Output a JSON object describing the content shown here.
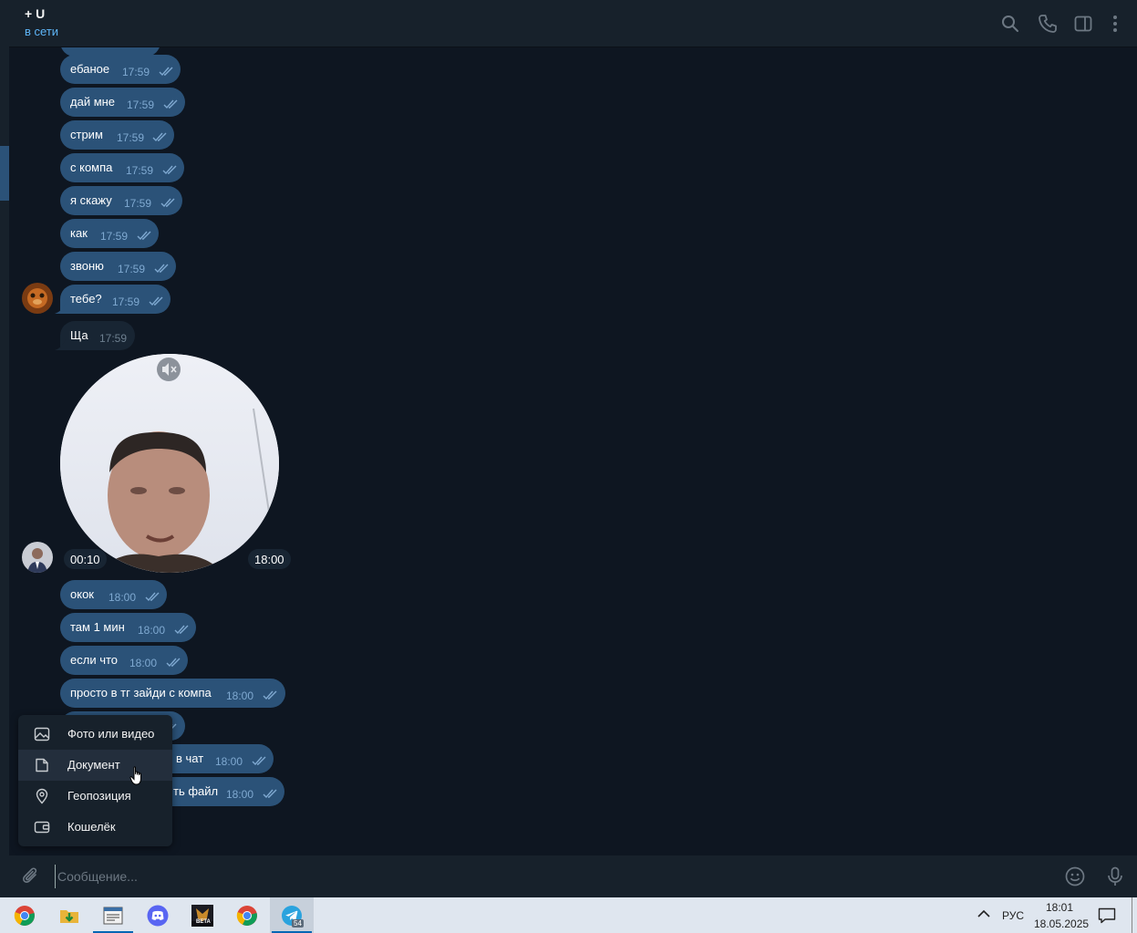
{
  "header": {
    "contact_name": "+ U",
    "status": "в сети",
    "icons": [
      "search-icon",
      "phone-icon",
      "sidebar-toggle-icon",
      "more-vertical-icon"
    ]
  },
  "messages": [
    {
      "text": "ебаное",
      "time": "17:59",
      "dir": "out"
    },
    {
      "text": "дай мне",
      "time": "17:59",
      "dir": "out"
    },
    {
      "text": "стрим",
      "time": "17:59",
      "dir": "out"
    },
    {
      "text": "с компа",
      "time": "17:59",
      "dir": "out"
    },
    {
      "text": "я скажу",
      "time": "17:59",
      "dir": "out"
    },
    {
      "text": "как",
      "time": "17:59",
      "dir": "out"
    },
    {
      "text": "звоню",
      "time": "17:59",
      "dir": "out"
    },
    {
      "text": "тебе?",
      "time": "17:59",
      "dir": "out"
    },
    {
      "text": "Ща",
      "time": "17:59",
      "dir": "in"
    },
    {
      "text": "окок",
      "time": "18:00",
      "dir": "out"
    },
    {
      "text": "там 1 мин",
      "time": "18:00",
      "dir": "out"
    },
    {
      "text": "если что",
      "time": "18:00",
      "dir": "out"
    },
    {
      "text": "просто в тг зайди с компа",
      "time": "18:00",
      "dir": "out"
    },
    {
      "text": "в чат",
      "time": "18:00",
      "dir": "out"
    },
    {
      "text": "ть файл",
      "time": "18:00",
      "dir": "out"
    }
  ],
  "video_message": {
    "duration": "00:10",
    "time": "18:00",
    "mute_icon": "speaker-muted-icon"
  },
  "attach_menu": {
    "items": [
      {
        "label": "Фото или видео",
        "icon": "image-icon"
      },
      {
        "label": "Документ",
        "icon": "document-icon"
      },
      {
        "label": "Геопозиция",
        "icon": "location-pin-icon"
      },
      {
        "label": "Кошелёк",
        "icon": "wallet-icon"
      }
    ],
    "hovered_index": 1
  },
  "composer": {
    "placeholder": "Сообщение...",
    "value": "",
    "icons": [
      "paperclip-icon",
      "emoji-icon",
      "microphone-icon"
    ]
  },
  "taskbar": {
    "apps": [
      "chrome-icon",
      "downloads-folder-icon",
      "notepad-icon",
      "discord-icon",
      "game-beta-icon",
      "chrome-icon",
      "telegram-icon"
    ],
    "beta_label": "BETA",
    "telegram_badge": "54",
    "language": "РУС",
    "time": "18:01",
    "date": "18.05.2025"
  },
  "colors": {
    "chat_bg": "#0e1621",
    "header_bg": "#17212b",
    "outgoing_bubble": "#2b5278",
    "incoming_bubble": "#182533",
    "accent": "#5eb5f7",
    "taskbar_bg": "#dfe6ef"
  }
}
